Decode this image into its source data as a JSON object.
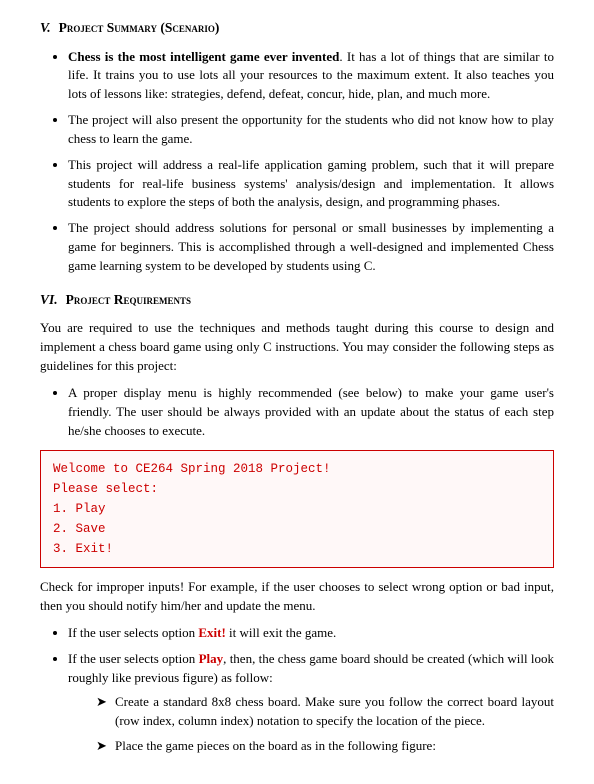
{
  "sections": [
    {
      "id": "section-5",
      "roman": "V.",
      "title": "Project Summary (Scenario)",
      "bullets": [
        {
          "id": "bullet-chess",
          "bold_prefix": "Chess is the most intelligent game ever invented",
          "text": ". It has a lot of things that are similar to life. It trains you to use lots all your resources to the maximum extent. It also teaches you lots of lessons like: strategies, defend, defeat, concur, hide, plan, and much more."
        },
        {
          "id": "bullet-present",
          "text": "The project will also present the opportunity for the students who did not know how to play chess to learn the game."
        },
        {
          "id": "bullet-address",
          "text": "This project will address a real-life application gaming problem, such that it will prepare students for real-life business systems' analysis/design and implementation. It allows students to explore the steps of both the analysis, design, and programming phases."
        },
        {
          "id": "bullet-personal",
          "text": "The project should address solutions for personal or small businesses by implementing a game for beginners. This is accomplished through a well-designed and implemented Chess game learning system to be developed by students using C."
        }
      ]
    },
    {
      "id": "section-6",
      "roman": "VI.",
      "title": "Project Requirements",
      "intro": "You are required to use the techniques and methods taught during this course to design and implement a chess board game using only C instructions. You may consider the following steps as guidelines for this project:",
      "bullets": [
        {
          "id": "bullet-display",
          "text": "A proper display menu is highly recommended (see below) to make your game user's friendly. The user should be always provided with an update about the status of each step he/she chooses to execute."
        }
      ],
      "code_box": [
        "Welcome to CE264 Spring 2018 Project!",
        "Please select:",
        "1. Play",
        "2. Save",
        "3. Exit!"
      ],
      "post_code_text": "Check for improper inputs! For example, if the user chooses to select wrong option or bad input, then you should notify him/her and update the menu.",
      "post_bullets": [
        {
          "id": "bullet-exit",
          "prefix": "If the user selects option ",
          "highlight": "Exit!",
          "suffix": " it will exit the game."
        },
        {
          "id": "bullet-play",
          "prefix": "If the user selects option ",
          "highlight": "Play",
          "suffix": ", then, the chess game board should be created (which will look roughly like previous figure) as follow:",
          "sub_bullets": [
            {
              "id": "sub-create",
              "text": "Create a standard 8x8 chess board. Make sure you follow the correct board layout (row index, column index) notation to specify the location of the piece."
            },
            {
              "id": "sub-place",
              "text": "Place the game pieces on the board as in the following figure:"
            }
          ]
        }
      ]
    }
  ],
  "labels": {
    "exit_highlight": "Exit!",
    "play_highlight": "Play",
    "arrow_symbol": "➤"
  }
}
